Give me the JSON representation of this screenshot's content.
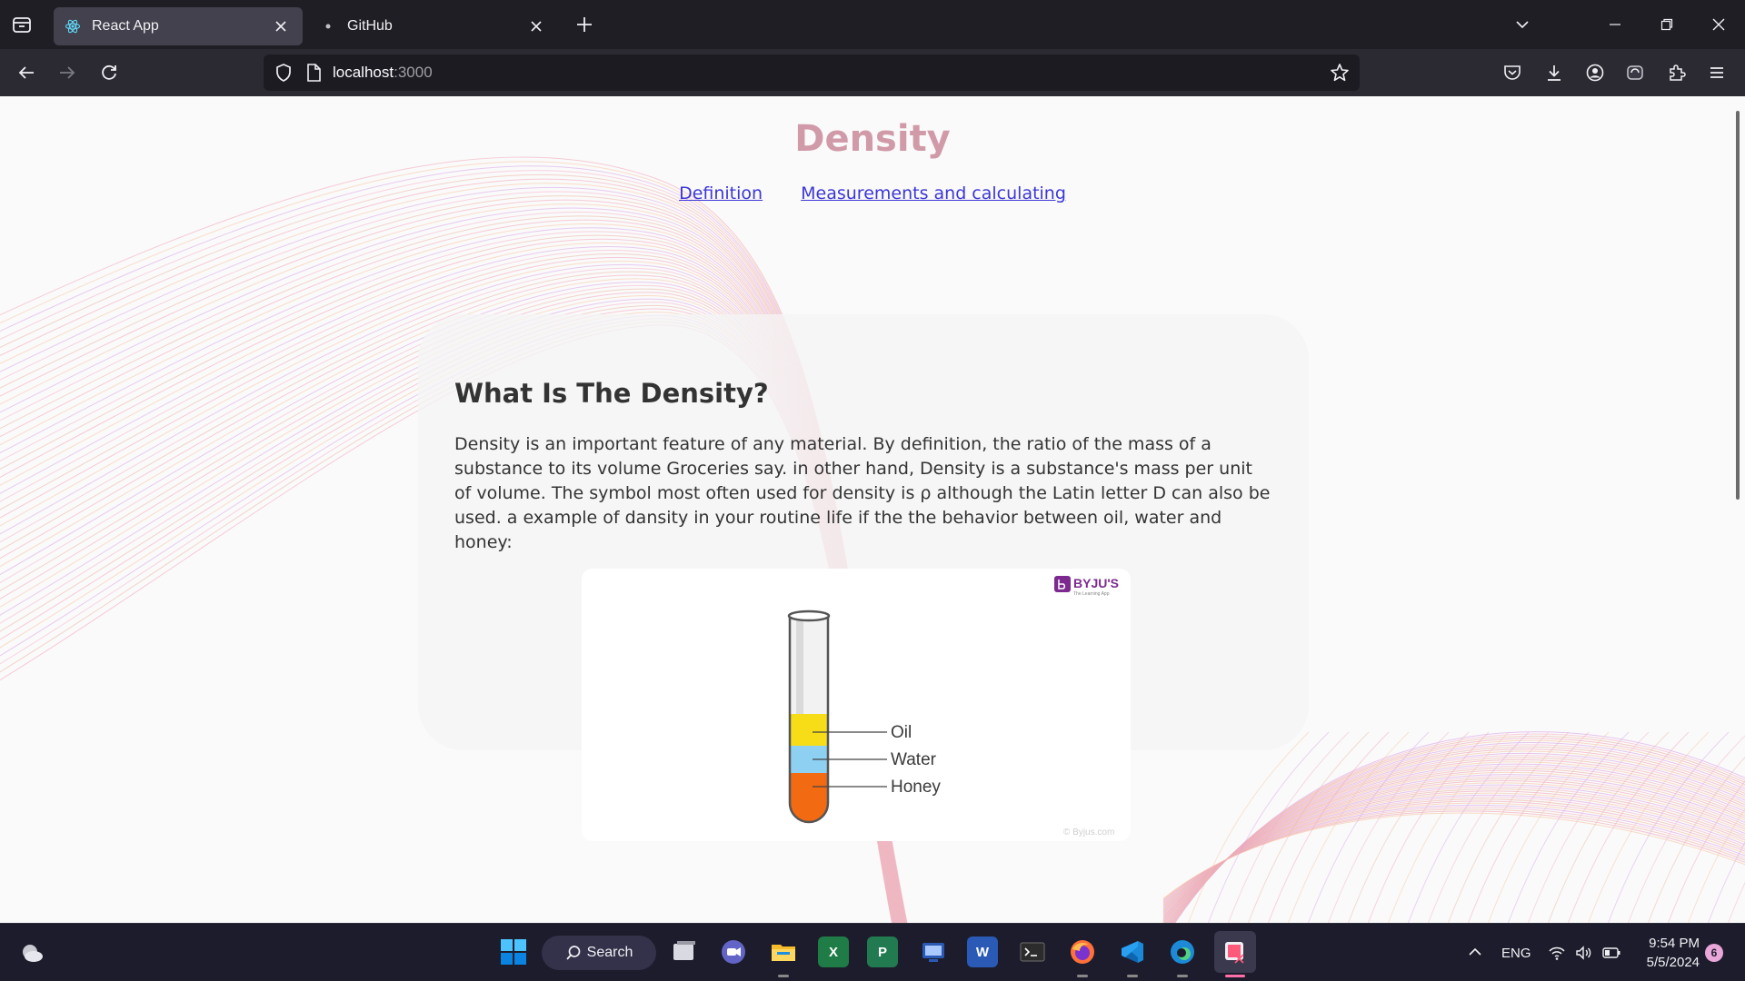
{
  "browser": {
    "tabs": [
      {
        "title": "React App",
        "active": true
      },
      {
        "title": "GitHub",
        "active": false
      }
    ],
    "url": {
      "host": "localhost",
      "port": ":3000"
    }
  },
  "page": {
    "title": "Density",
    "nav": [
      "Definition",
      "Measurements and calculating"
    ],
    "section_heading": "What Is The Density?",
    "paragraph": "Density is an important feature of any material. By definition, the ratio of the mass of a substance to its volume Groceries say. in other hand, Density is a substance's mass per unit of volume. The symbol most often used for density is ρ although the Latin letter D can also be used. a example of dansity in your routine life if the the behavior between oil, water and honey:",
    "figure": {
      "brand": "BYJU'S",
      "brand_sub": "The Learning App",
      "labels": [
        "Oil",
        "Water",
        "Honey"
      ],
      "credit": "© Byjus.com"
    }
  },
  "taskbar": {
    "search_label": "Search",
    "language": "ENG",
    "time": "9:54 PM",
    "date": "5/5/2024",
    "notification_count": "6"
  }
}
